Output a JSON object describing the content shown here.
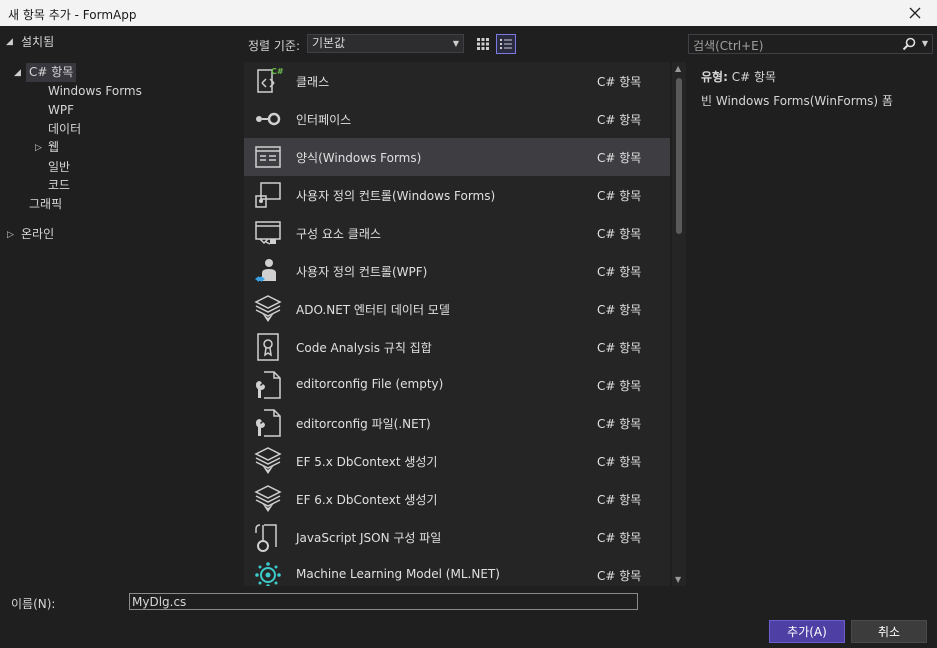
{
  "window": {
    "title": "새 항목 추가 - FormApp"
  },
  "sidebar": {
    "root_label": "설치됨",
    "csharp_label": "C# 항목",
    "children": [
      "Windows Forms",
      "WPF",
      "데이터",
      "웹",
      "일반",
      "코드"
    ],
    "graphics_label": "그래픽",
    "online_label": "온라인"
  },
  "toolbar": {
    "sort_label": "정렬 기준:",
    "sort_value": "기본값"
  },
  "search": {
    "placeholder": "검색(Ctrl+E)"
  },
  "list": {
    "selected_index": 2,
    "items": [
      {
        "name": "클래스",
        "type": "C# 항목",
        "icon": "class-icon"
      },
      {
        "name": "인터페이스",
        "type": "C# 항목",
        "icon": "interface-icon"
      },
      {
        "name": "양식(Windows Forms)",
        "type": "C# 항목",
        "icon": "form-icon"
      },
      {
        "name": "사용자 정의 컨트롤(Windows Forms)",
        "type": "C# 항목",
        "icon": "user-control-icon"
      },
      {
        "name": "구성 요소 클래스",
        "type": "C# 항목",
        "icon": "component-class-icon"
      },
      {
        "name": "사용자 정의 컨트롤(WPF)",
        "type": "C# 항목",
        "icon": "wpf-user-control-icon"
      },
      {
        "name": "ADO.NET 엔터티 데이터 모델",
        "type": "C# 항목",
        "icon": "entity-model-icon"
      },
      {
        "name": "Code Analysis 규칙 집합",
        "type": "C# 항목",
        "icon": "ruleset-icon"
      },
      {
        "name": "editorconfig File (empty)",
        "type": "C# 항목",
        "icon": "editorconfig-icon"
      },
      {
        "name": "editorconfig 파일(.NET)",
        "type": "C# 항목",
        "icon": "editorconfig-icon"
      },
      {
        "name": "EF 5.x DbContext 생성기",
        "type": "C# 항목",
        "icon": "dbcontext-generator-icon"
      },
      {
        "name": "EF 6.x DbContext 생성기",
        "type": "C# 항목",
        "icon": "dbcontext-generator-icon"
      },
      {
        "name": "JavaScript JSON 구성 파일",
        "type": "C# 항목",
        "icon": "json-config-icon"
      },
      {
        "name": "Machine Learning Model (ML.NET)",
        "type": "C# 항목",
        "icon": "ml-model-icon"
      }
    ]
  },
  "details": {
    "type_label": "유형:",
    "type_value": "C# 항목",
    "description": "빈 Windows Forms(WinForms) 폼"
  },
  "footer": {
    "name_label": "이름(N):",
    "name_value": "MyDlg.cs",
    "add_label": "추가(A)",
    "cancel_label": "취소"
  },
  "colors": {
    "accent": "#4d3fa3",
    "background": "#1f1f1f",
    "list_bg": "#252526",
    "selected_row": "#3e3e42"
  }
}
